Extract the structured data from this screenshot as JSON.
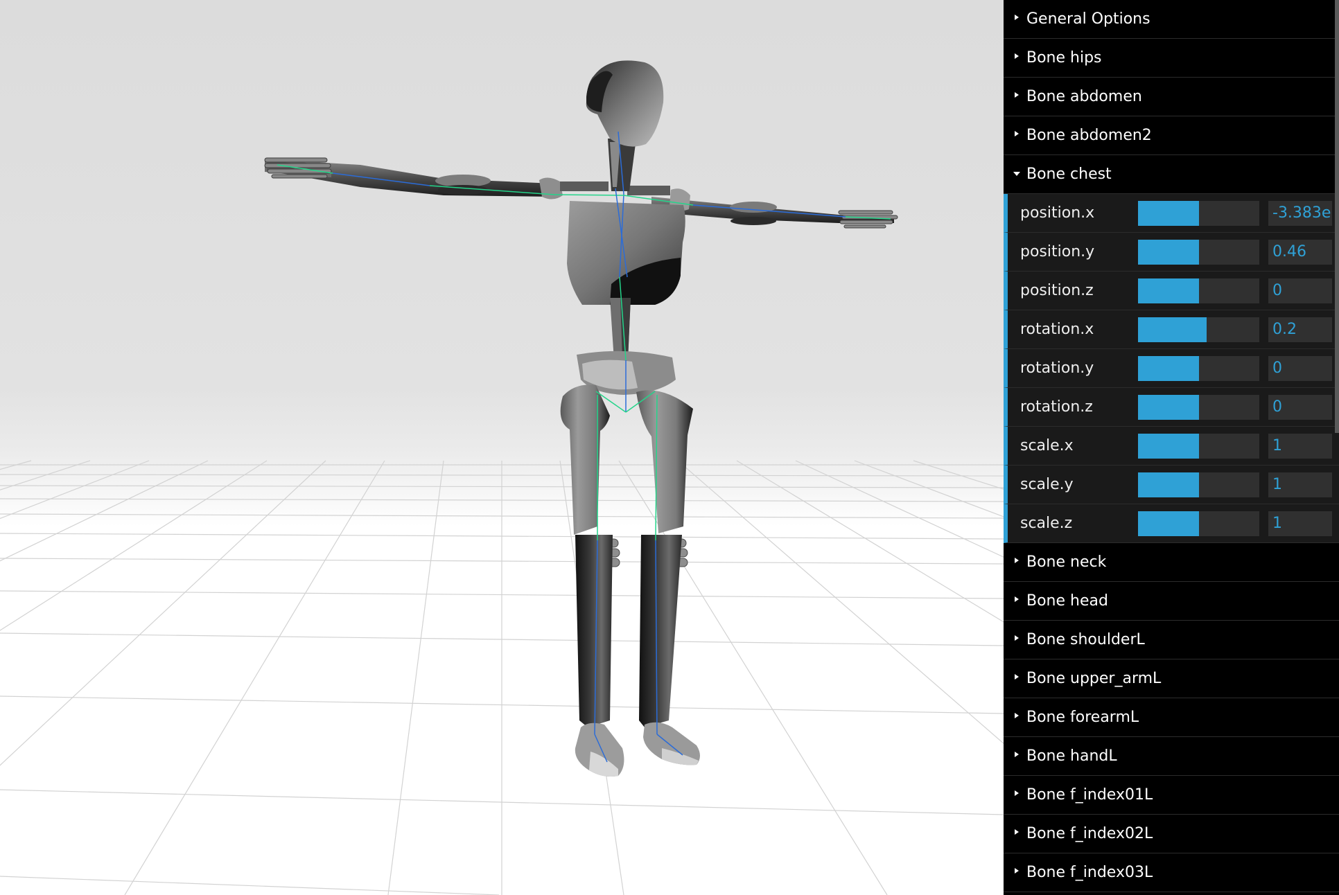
{
  "gui": {
    "folders_top": [
      {
        "label": "General Options",
        "open": false
      },
      {
        "label": "Bone hips",
        "open": false
      },
      {
        "label": "Bone abdomen",
        "open": false
      },
      {
        "label": "Bone abdomen2",
        "open": false
      }
    ],
    "active_folder": {
      "label": "Bone chest",
      "open": true
    },
    "controls": [
      {
        "label": "position.x",
        "value": "-3.383e",
        "fill_fraction": 0.5
      },
      {
        "label": "position.y",
        "value": "0.46",
        "fill_fraction": 0.5
      },
      {
        "label": "position.z",
        "value": "0",
        "fill_fraction": 0.5
      },
      {
        "label": "rotation.x",
        "value": "0.2",
        "fill_fraction": 0.565
      },
      {
        "label": "rotation.y",
        "value": "0",
        "fill_fraction": 0.5
      },
      {
        "label": "rotation.z",
        "value": "0",
        "fill_fraction": 0.5
      },
      {
        "label": "scale.x",
        "value": "1",
        "fill_fraction": 0.5
      },
      {
        "label": "scale.y",
        "value": "1",
        "fill_fraction": 0.5
      },
      {
        "label": "scale.z",
        "value": "1",
        "fill_fraction": 0.5
      }
    ],
    "folders_bottom": [
      {
        "label": "Bone neck",
        "open": false
      },
      {
        "label": "Bone head",
        "open": false
      },
      {
        "label": "Bone shoulderL",
        "open": false
      },
      {
        "label": "Bone upper_armL",
        "open": false
      },
      {
        "label": "Bone forearmL",
        "open": false
      },
      {
        "label": "Bone handL",
        "open": false
      },
      {
        "label": "Bone f_index01L",
        "open": false
      },
      {
        "label": "Bone f_index02L",
        "open": false
      },
      {
        "label": "Bone f_index03L",
        "open": false
      }
    ]
  },
  "colors": {
    "accent": "#2fa1d6",
    "panel_bg": "#000000",
    "control_bg": "#1a1a1a",
    "skeleton_bone": "#2b6cd8",
    "skeleton_joint": "#24d48a"
  }
}
